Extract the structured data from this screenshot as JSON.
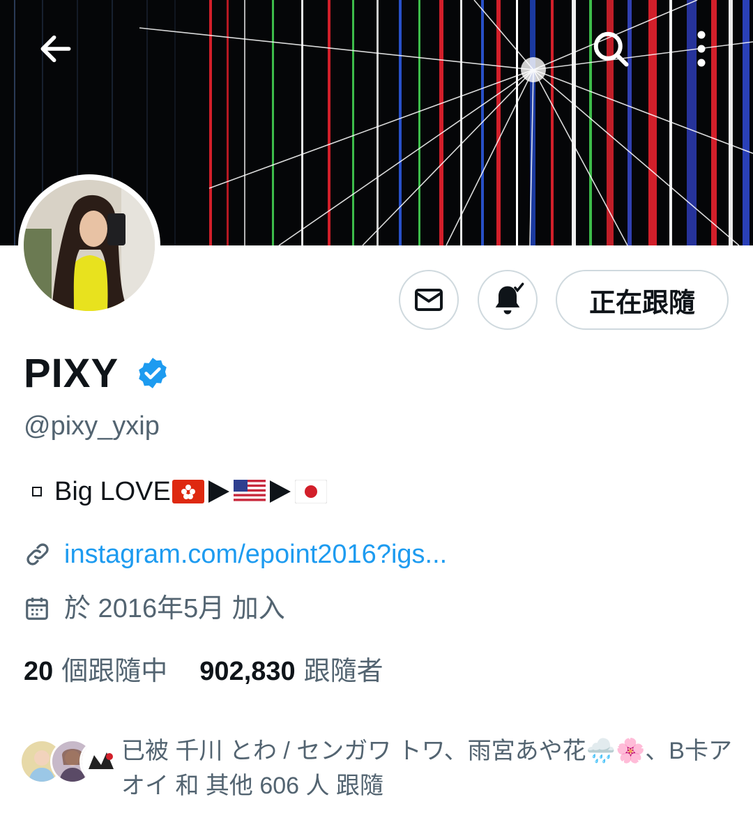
{
  "profile": {
    "name": "PIXY",
    "handle": "@pixy_yxip",
    "bio_text": "Big LOVE",
    "link": "instagram.com/epoint2016?igs...",
    "joined": "於 2016年5月 加入"
  },
  "actions": {
    "follow_label": "正在跟隨"
  },
  "stats": {
    "following_count": "20",
    "following_label": "個跟隨中",
    "followers_count": "902,830",
    "followers_label": "跟隨者"
  },
  "known_followers": {
    "text": "已被 千川 とわ / センガワ トワ、雨宮あや花🌧️🌸、B卡アオイ 和 其他 606 人 跟隨"
  },
  "colors": {
    "accent": "#1d9bf0",
    "secondary_text": "#536471",
    "border": "#cfd9de"
  },
  "icons": [
    "back-arrow-icon",
    "search-icon",
    "more-vertical-icon",
    "mail-icon",
    "bell-icon",
    "verified-badge-icon",
    "link-icon",
    "calendar-icon"
  ]
}
